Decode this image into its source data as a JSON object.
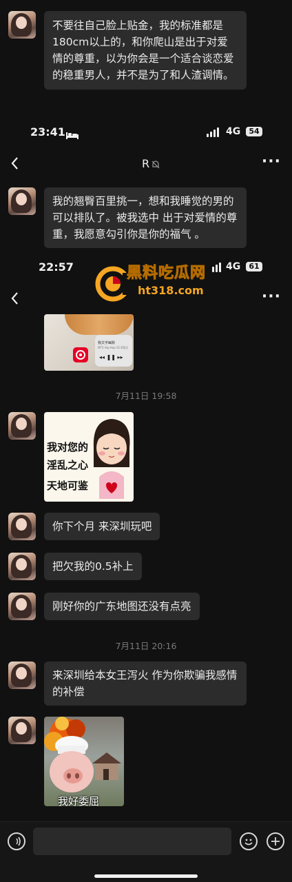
{
  "messages": {
    "m1": "不要往自己脸上贴金，我的标准都是180cm以上的，和你爬山是出于对爱情的尊重，以为你会是一个适合谈恋爱的稳重男人，并不是为了和人渣调情。",
    "m2": "我的翘臀百里挑一，想和我睡觉的男的可以排队了。被我选中 出于对爱情的尊重，我愿意勾引你是你的福气 。",
    "m3": "你下个月 来深圳玩吧",
    "m4": "把欠我的0.5补上",
    "m5": "刚好你的广东地图还没有点亮",
    "m6": "来深圳给本女王泻火 作为你欺骗我感情的补偿"
  },
  "status1": {
    "time": "23:41",
    "network": "4G",
    "battery": "54"
  },
  "status2": {
    "time": "22:57",
    "network": "4G",
    "battery": "61"
  },
  "nav1": {
    "title": "R"
  },
  "timestamps": {
    "t1": "7月11日 19:58",
    "t2": "7月11日 20:16"
  },
  "sticker1": {
    "line1": "我对您的",
    "line2": "淫乱之心",
    "line3": "天地可鉴"
  },
  "sticker2": {
    "caption": "我好委屈"
  },
  "music_widget": {
    "text": "我文字幽默",
    "sub": "MTS Hip-Hop 01 B音乐"
  },
  "watermark": {
    "text": "黑料吃瓜网",
    "url": "ht318.com"
  },
  "colors": {
    "bg": "#111111",
    "bubble": "#2c2c2c",
    "text": "#ebebeb",
    "timestamp": "#7a7a7a",
    "watermark": "#f5a623"
  }
}
